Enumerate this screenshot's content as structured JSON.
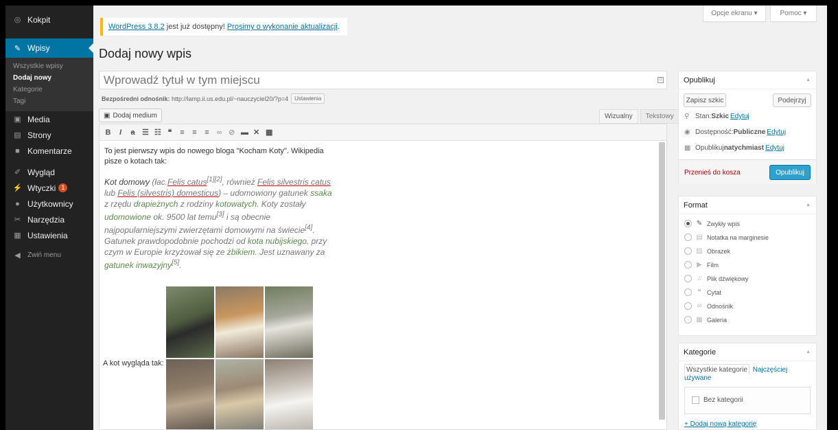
{
  "sidebar": {
    "items": [
      {
        "label": "Kokpit"
      },
      {
        "label": "Wpisy"
      },
      {
        "label": "Media"
      },
      {
        "label": "Strony"
      },
      {
        "label": "Komentarze"
      },
      {
        "label": "Wygląd"
      },
      {
        "label": "Wtyczki"
      },
      {
        "label": "Użytkownicy"
      },
      {
        "label": "Narzędzia"
      },
      {
        "label": "Ustawienia"
      }
    ],
    "submenu": [
      "Wszystkie wpisy",
      "Dodaj nowy",
      "Kategorie",
      "Tagi"
    ],
    "plugins_badge": "1",
    "collapse": "Zwiń menu"
  },
  "top": {
    "screen_options": "Opcje ekranu",
    "help": "Pomoc"
  },
  "notice": {
    "link1": "WordPress 3.8.2",
    "text": " jest już dostępny! ",
    "link2": "Prosimy o wykonanie aktualizacji",
    "end": "."
  },
  "page_title": "Dodaj nowy wpis",
  "title_placeholder": "Wprowadź tytuł w tym miejscu",
  "permalink": {
    "label": "Bezpośredni odnośnik:",
    "url": "http://lamp.ii.us.edu.pl/~nauczyciel20/?p=4",
    "button": "Ustawienia"
  },
  "editor": {
    "add_media": "Dodaj medium",
    "tab_visual": "Wizualny",
    "tab_text": "Tekstowy",
    "intro": "To jest pierwszy wpis do nowego bloga \"Kocham Koty\". Wikipedia pisze o kotach tak:",
    "quote": {
      "p1": "Kot domowy",
      "p2": " (łac.",
      "p3": "Felis catus",
      "p4": "[1][2]",
      "p5": ", również ",
      "p6": "Felis silvestris catus",
      "p7": " lub ",
      "p8": "Felis (silvestris) domesticus",
      "p9": ") – udomowiony gatunek ",
      "p10": "ssaka",
      "p11": " z rzędu ",
      "p12": "drapieżnych",
      "p13": " z rodziny ",
      "p14": "kotowatych",
      "p15": ". Koty zostały ",
      "p16": "udomowione",
      "p17": " ok. 9500 lat temu",
      "p18": "[3]",
      "p19": " i są obecnie najpopularniejszymi zwierzętami domowymi na świecie",
      "p20": "[4]",
      "p21": ". Gatunek prawdopodobnie pochodzi od ",
      "p22": "kota nubijskiego",
      "p23": ", przy czym w Europie krzyżował się ze ",
      "p24": "żbikiem",
      "p25": ". Jest uznawany za ",
      "p26": "gatunek inwazyjny",
      "p27": "[5]",
      "p28": "."
    },
    "image_label": "A kot wygląda tak:"
  },
  "publish": {
    "title": "Opublikuj",
    "save_draft": "Zapisz szkic",
    "preview": "Podejrzyj",
    "status_label": "Stan: ",
    "status_value": "Szkic",
    "edit": "Edytuj",
    "visibility_label": "Dostępność: ",
    "visibility_value": "Publiczne",
    "publish_label": "Opublikuj ",
    "publish_value": "natychmiast",
    "trash": "Przenieś do kosza",
    "publish_btn": "Opublikuj"
  },
  "format": {
    "title": "Format",
    "options": [
      "Zwykły wpis",
      "Notatka na marginesie",
      "Obrazek",
      "Film",
      "Plik dźwiękowy",
      "Cytat",
      "Odnośnik",
      "Galeria"
    ]
  },
  "categories": {
    "title": "Kategorie",
    "tab_all": "Wszystkie kategorie",
    "tab_popular": "Najczęściej używane",
    "item": "Bez kategorii",
    "add_new": "+ Dodaj nową kategorię"
  },
  "colors": {
    "accent": "#0074a2",
    "sidebar": "#222222",
    "notice": "#ffba00",
    "badge": "#d54e21",
    "publish": "#2ea2cc"
  }
}
